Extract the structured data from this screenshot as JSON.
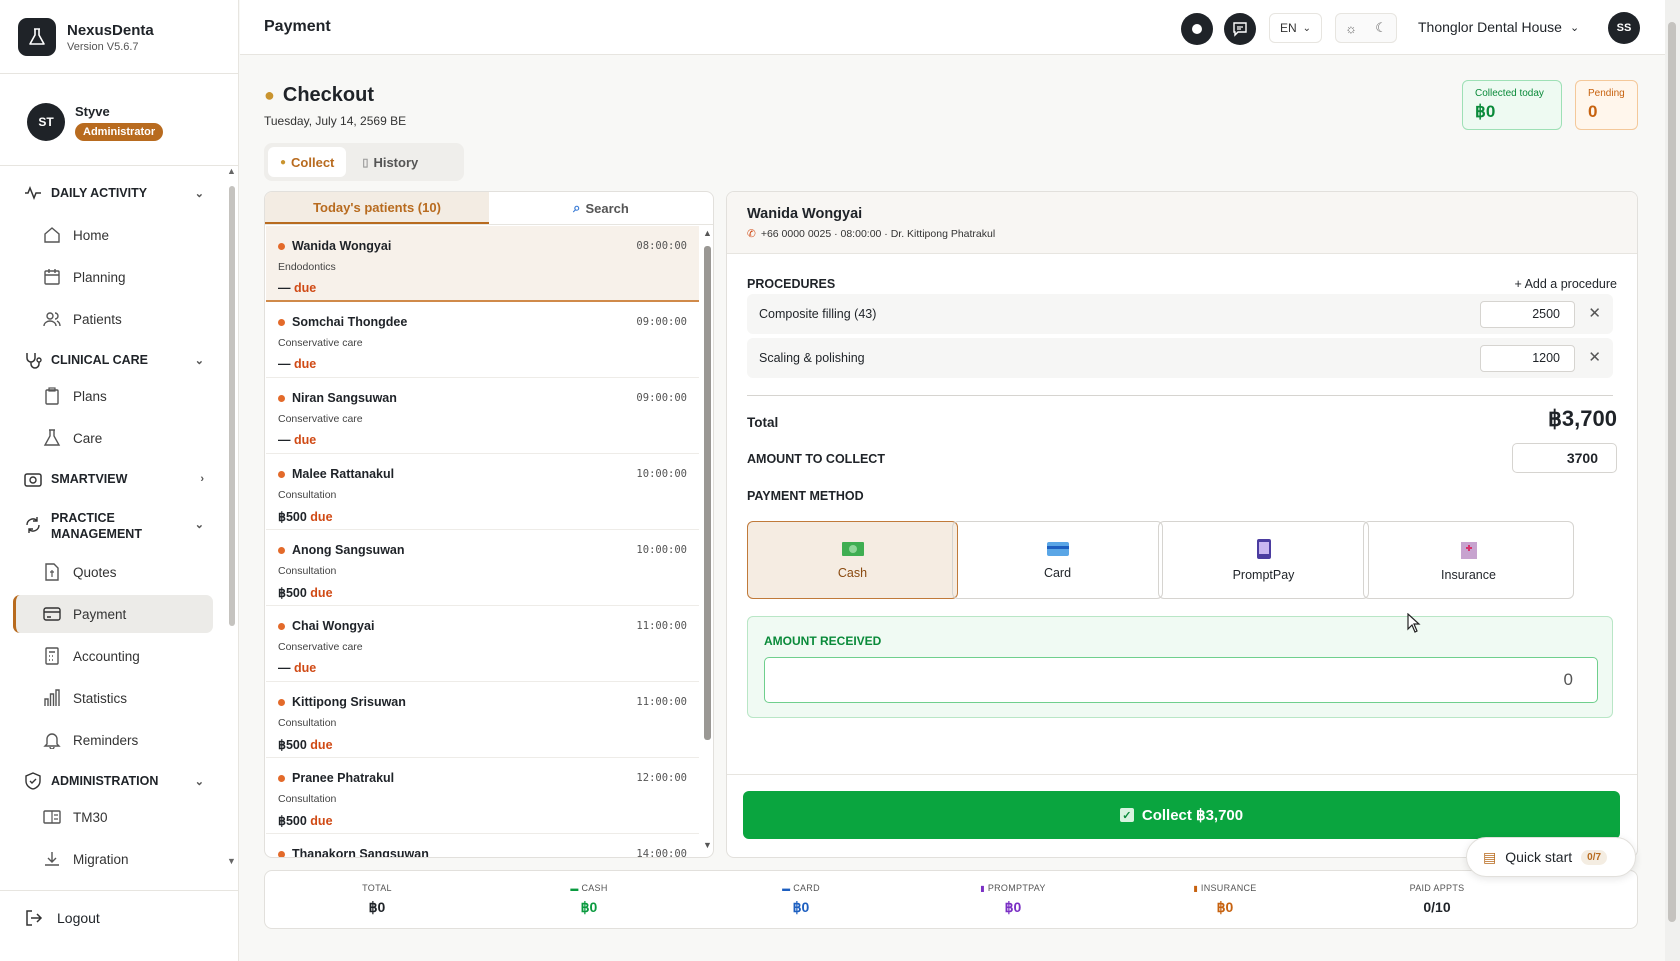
{
  "app": {
    "name": "NexusDenta",
    "version": "Version V5.6.7"
  },
  "user": {
    "initials": "ST",
    "name": "Styve",
    "role": "Administrator"
  },
  "nav": {
    "daily_activity": "DAILY ACTIVITY",
    "home": "Home",
    "planning": "Planning",
    "patients": "Patients",
    "clinical_care": "CLINICAL CARE",
    "plans": "Plans",
    "care": "Care",
    "smartview": "SMARTVIEW",
    "practice_management_l1": "PRACTICE",
    "practice_management_l2": "MANAGEMENT",
    "quotes": "Quotes",
    "payment": "Payment",
    "accounting": "Accounting",
    "statistics": "Statistics",
    "reminders": "Reminders",
    "administration": "ADMINISTRATION",
    "tm30": "TM30",
    "migration": "Migration",
    "logout": "Logout"
  },
  "topbar": {
    "page_title": "Payment",
    "language": "EN",
    "clinic": "Thonglor Dental House",
    "user_initials": "SS"
  },
  "checkout": {
    "title": "Checkout",
    "date": "Tuesday, July 14, 2569 BE",
    "collected_today_label": "Collected today",
    "collected_today_value": "฿0",
    "pending_label": "Pending",
    "pending_value": "0",
    "tab_collect": "Collect",
    "tab_history": "History"
  },
  "patient_list": {
    "tab_today": "Today's patients (10)",
    "tab_search": "Search",
    "patients": [
      {
        "name": "Wanida Wongyai",
        "time": "08:00:00",
        "type": "Endodontics",
        "amount": "—",
        "status": "due"
      },
      {
        "name": "Somchai Thongdee",
        "time": "09:00:00",
        "type": "Conservative care",
        "amount": "—",
        "status": "due"
      },
      {
        "name": "Niran Sangsuwan",
        "time": "09:00:00",
        "type": "Conservative care",
        "amount": "—",
        "status": "due"
      },
      {
        "name": "Malee Rattanakul",
        "time": "10:00:00",
        "type": "Consultation",
        "amount": "฿500",
        "status": "due"
      },
      {
        "name": "Anong Sangsuwan",
        "time": "10:00:00",
        "type": "Consultation",
        "amount": "฿500",
        "status": "due"
      },
      {
        "name": "Chai Wongyai",
        "time": "11:00:00",
        "type": "Conservative care",
        "amount": "—",
        "status": "due"
      },
      {
        "name": "Kittipong Srisuwan",
        "time": "11:00:00",
        "type": "Consultation",
        "amount": "฿500",
        "status": "due"
      },
      {
        "name": "Pranee Phatrakul",
        "time": "12:00:00",
        "type": "Consultation",
        "amount": "฿500",
        "status": "due"
      },
      {
        "name": "Thanakorn Sangsuwan",
        "time": "14:00:00",
        "type": "",
        "amount": "",
        "status": ""
      }
    ]
  },
  "detail": {
    "patient_name": "Wanida Wongyai",
    "patient_sub": "+66 0000 0025 · 08:00:00 · Dr. Kittipong Phatrakul",
    "procedures_label": "PROCEDURES",
    "add_procedure": "+ Add a procedure",
    "procedures": [
      {
        "name": "Composite filling (43)",
        "price": "2500"
      },
      {
        "name": "Scaling & polishing",
        "price": "1200"
      }
    ],
    "total_label": "Total",
    "total_value": "฿3,700",
    "amount_to_collect_label": "AMOUNT TO COLLECT",
    "amount_to_collect_value": "3700",
    "payment_method_label": "PAYMENT METHOD",
    "methods": [
      "Cash",
      "Card",
      "PromptPay",
      "Insurance"
    ],
    "selected_method": "Cash",
    "amount_received_label": "AMOUNT RECEIVED",
    "amount_received_value": "0",
    "collect_button": "Collect ฿3,700"
  },
  "summary": [
    {
      "label": "TOTAL",
      "value": "฿0",
      "color": "#1f2328"
    },
    {
      "label": "CASH",
      "value": "฿0",
      "color": "#0a9a3f"
    },
    {
      "label": "CARD",
      "value": "฿0",
      "color": "#1d5fc0"
    },
    {
      "label": "PROMPTPAY",
      "value": "฿0",
      "color": "#7a2fc4"
    },
    {
      "label": "INSURANCE",
      "value": "฿0",
      "color": "#c7620f"
    },
    {
      "label": "PAID APPTS",
      "value": "0/10",
      "color": "#1f2328"
    }
  ],
  "quick_start": {
    "label": "Quick start",
    "badge": "0/7"
  },
  "colors": {
    "accent": "#b86b1f",
    "success": "#0aa53f",
    "due": "#d04a15"
  }
}
